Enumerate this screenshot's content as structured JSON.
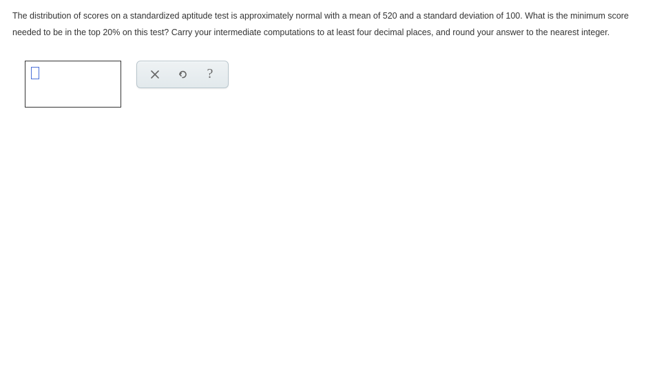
{
  "question": {
    "text": "The distribution of scores on a standardized aptitude test is approximately normal with a mean of 520 and a standard deviation of 100. What is the minimum score needed to be in the top 20% on this test? Carry your intermediate computations to at least four decimal places, and round your answer to the nearest integer."
  },
  "answer": {
    "value": ""
  },
  "toolbar": {
    "clear_label": "Clear",
    "undo_label": "Undo",
    "help_label": "?"
  }
}
